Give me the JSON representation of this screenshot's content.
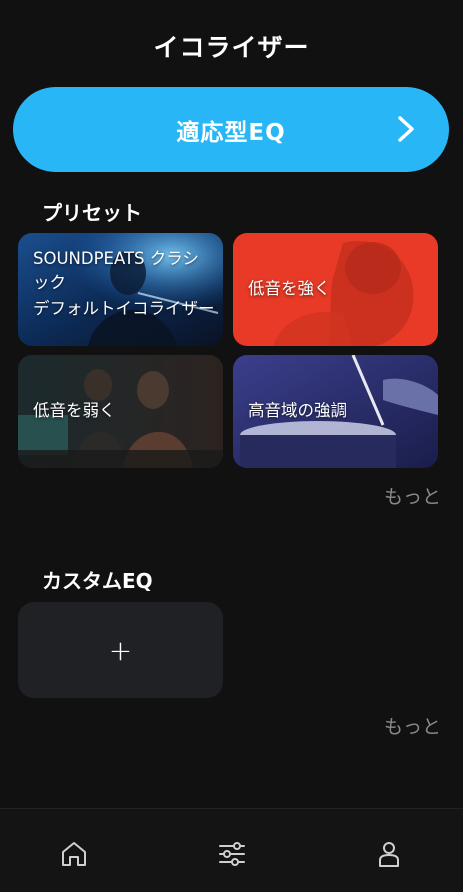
{
  "header": {
    "title": "イコライザー"
  },
  "adaptive_eq": {
    "label": "適応型EQ",
    "icon": "chevron-right-icon",
    "color": "#29b6f6"
  },
  "presets": {
    "title": "プリセット",
    "items": [
      {
        "line1": "SOUNDPEATS クラシ",
        "line2": "ック",
        "line3": "デフォルトイコライザー"
      },
      {
        "label": "低音を強く"
      },
      {
        "label": "低音を弱く"
      },
      {
        "label": "高音域の強調"
      }
    ],
    "more": "もっと"
  },
  "custom_eq": {
    "title": "カスタムEQ",
    "add_label": "+",
    "more": "もっと"
  },
  "nav": {
    "items": [
      {
        "icon": "home-icon"
      },
      {
        "icon": "equalizer-sliders-icon"
      },
      {
        "icon": "profile-icon"
      }
    ]
  }
}
